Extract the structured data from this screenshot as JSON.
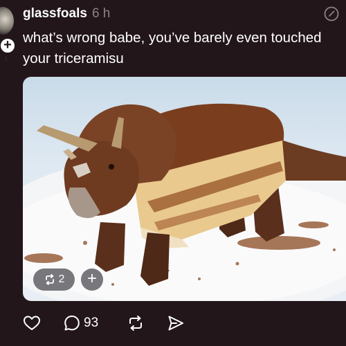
{
  "post": {
    "username": "glassfoals",
    "timestamp": "6 h",
    "caption": "what’s wrong babe, you’ve barely even touched your triceramisu",
    "media": {
      "repost_count": "2"
    },
    "actions": {
      "comment_count": "93"
    },
    "icons": {
      "avatar": "avatar",
      "follow": "plus-icon",
      "edit": "edit-icon",
      "like": "heart-icon",
      "comment": "comment-icon",
      "repost": "repost-icon",
      "share": "send-icon"
    }
  },
  "colors": {
    "background": "#22161a",
    "text": "#ffffff",
    "muted": "#8c8288",
    "chip": "#5a5a5f"
  }
}
